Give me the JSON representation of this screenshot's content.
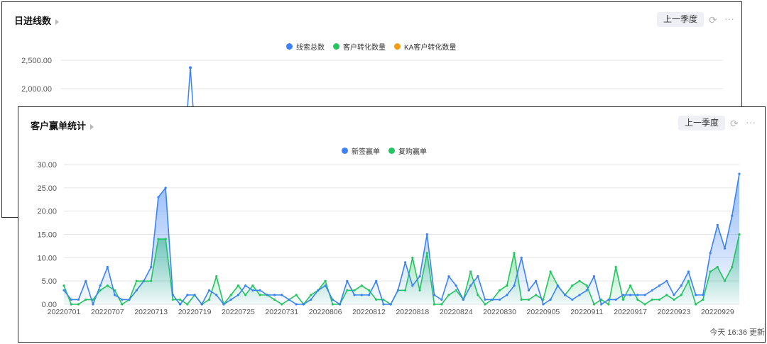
{
  "back_card": {
    "title": "日进线数",
    "period_button": "上一季度",
    "icons": [
      "refresh-icon",
      "more-icon"
    ],
    "legend": [
      {
        "name": "线索总数",
        "color": "#3b82f6"
      },
      {
        "name": "客户转化数量",
        "color": "#22c55e"
      },
      {
        "name": "KA客户转化数量",
        "color": "#f59e0b"
      }
    ]
  },
  "front_card": {
    "title": "客户赢单统计",
    "period_button": "上一季度",
    "icons": [
      "refresh-icon",
      "more-icon"
    ],
    "legend": [
      {
        "name": "新签赢单",
        "color": "#3b82f6"
      },
      {
        "name": "复购赢单",
        "color": "#22c55e"
      }
    ],
    "footer": "今天 16:36 更新"
  },
  "chart_data": [
    {
      "type": "line",
      "ylim": [
        0,
        2500
      ],
      "y_ticks": [
        "2,500.00",
        "2,000.00"
      ],
      "series": [
        {
          "name": "线索总数",
          "color": "#3b82f6",
          "visible_peak": 2370
        },
        {
          "name": "客户转化数量",
          "color": "#22c55e"
        },
        {
          "name": "KA客户转化数量",
          "color": "#f59e0b"
        }
      ]
    },
    {
      "type": "area",
      "ylim": [
        0,
        30
      ],
      "y_ticks": [
        "30.00",
        "25.00",
        "20.00",
        "15.00",
        "10.00",
        "5.00",
        "0.00"
      ],
      "x_tick_labels": [
        "20220701",
        "20220707",
        "20220713",
        "20220719",
        "20220725",
        "20220731",
        "20220806",
        "20220812",
        "20220818",
        "20220824",
        "20220830",
        "20220905",
        "20220911",
        "20220917",
        "20220923",
        "20220929"
      ],
      "series": [
        {
          "name": "新签赢单",
          "color": "#3b82f6",
          "values": [
            3,
            1,
            1,
            5,
            0,
            4,
            8,
            2,
            1,
            1,
            3,
            5,
            8,
            23,
            25,
            2,
            0,
            2,
            2,
            0,
            3,
            2,
            0,
            1,
            2,
            4,
            3,
            3,
            2,
            2,
            2,
            1,
            0,
            0,
            1,
            3,
            4,
            1,
            0,
            5,
            2,
            2,
            2,
            5,
            0,
            0,
            3,
            9,
            4,
            6,
            15,
            2,
            1,
            6,
            4,
            1,
            4,
            6,
            1,
            1,
            1,
            2,
            4,
            10,
            3,
            5,
            0,
            1,
            4,
            2,
            1,
            2,
            3,
            6,
            0,
            1,
            1,
            2,
            2,
            2,
            2,
            3,
            4,
            5,
            2,
            4,
            7,
            2,
            2,
            11,
            17,
            12,
            19,
            28
          ]
        },
        {
          "name": "复购赢单",
          "color": "#22c55e",
          "values": [
            4,
            0,
            0,
            1,
            1,
            3,
            4,
            3,
            0,
            1,
            5,
            5,
            5,
            14,
            14,
            1,
            1,
            0,
            2,
            0,
            1,
            6,
            0,
            2,
            4,
            2,
            4,
            2,
            2,
            1,
            0,
            1,
            2,
            0,
            2,
            3,
            5,
            0,
            0,
            3,
            3,
            4,
            3,
            1,
            1,
            0,
            3,
            3,
            10,
            3,
            11,
            0,
            0,
            2,
            3,
            1,
            7,
            2,
            0,
            1,
            3,
            4,
            11,
            1,
            1,
            2,
            1,
            7,
            4,
            2,
            4,
            5,
            4,
            0,
            1,
            0,
            8,
            1,
            4,
            1,
            0,
            1,
            1,
            2,
            1,
            2,
            5,
            0,
            1,
            7,
            8,
            5,
            8,
            15
          ]
        }
      ]
    }
  ]
}
